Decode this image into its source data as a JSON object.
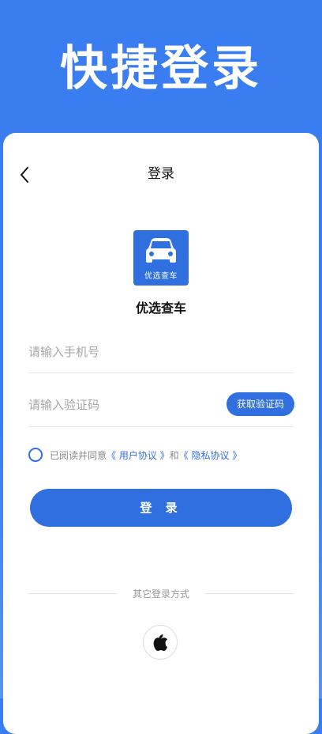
{
  "hero": {
    "title": "快捷登录"
  },
  "nav": {
    "title": "登录"
  },
  "app": {
    "logo_text": "优选查车",
    "name": "优选查车"
  },
  "form": {
    "phone_placeholder": "请输入手机号",
    "code_placeholder": "请输入验证码",
    "get_code_label": "获取验证码"
  },
  "agreement": {
    "prefix": "已阅读并同意",
    "user_agreement": "《 用户协议 》",
    "and": "和",
    "privacy_policy": "《 隐私协议 》"
  },
  "login_button_label": "登 录",
  "other_login": {
    "label": "其它登录方式"
  },
  "colors": {
    "primary": "#2f6fe0",
    "background": "#3a7df0"
  },
  "icons": {
    "back": "chevron-left-icon",
    "logo": "car-icon",
    "apple": "apple-icon"
  }
}
